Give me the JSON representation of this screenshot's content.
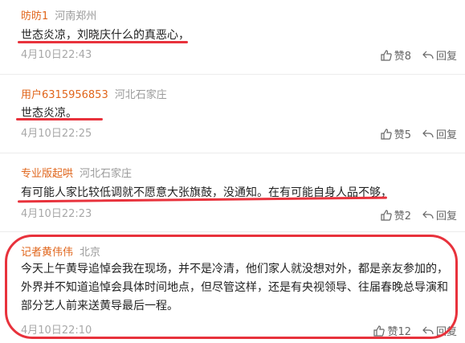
{
  "comments": [
    {
      "user": "昉昉1",
      "location": "河南郑州",
      "text": "世态炎凉，刘晓庆什么的真恶心，",
      "time": "4月10日22:43",
      "likes": "赞8",
      "reply": "回复"
    },
    {
      "user": "用户6315956853",
      "location": "河北石家庄",
      "text": "世态炎凉。",
      "time": "4月10日22:25",
      "likes": "赞5",
      "reply": "回复"
    },
    {
      "user": "专业版起哄",
      "location": "河北石家庄",
      "text": "有可能人家比较低调就不愿意大张旗鼓，没通知。在有可能自身人品不够，",
      "time": "4月10日22:23",
      "likes": "赞2",
      "reply": "回复"
    },
    {
      "user": "记者黄伟伟",
      "location": "北京",
      "text": "今天上午黄导追悼会我在现场，并不是冷清，他们家人就没想对外，都是亲友参加的，外界并不知道追悼会具体时间地点，但尽管这样，还是有央视领导、往届春晚总导演和部分艺人前来送黄导最后一程。",
      "time": "4月10日22:10",
      "likes": "赞12",
      "reply": "回复"
    }
  ],
  "colors": {
    "username": "#e0651b",
    "annotation": "#e8323c"
  },
  "icons": {
    "like": "thumbs-up-icon",
    "reply": "reply-icon"
  }
}
